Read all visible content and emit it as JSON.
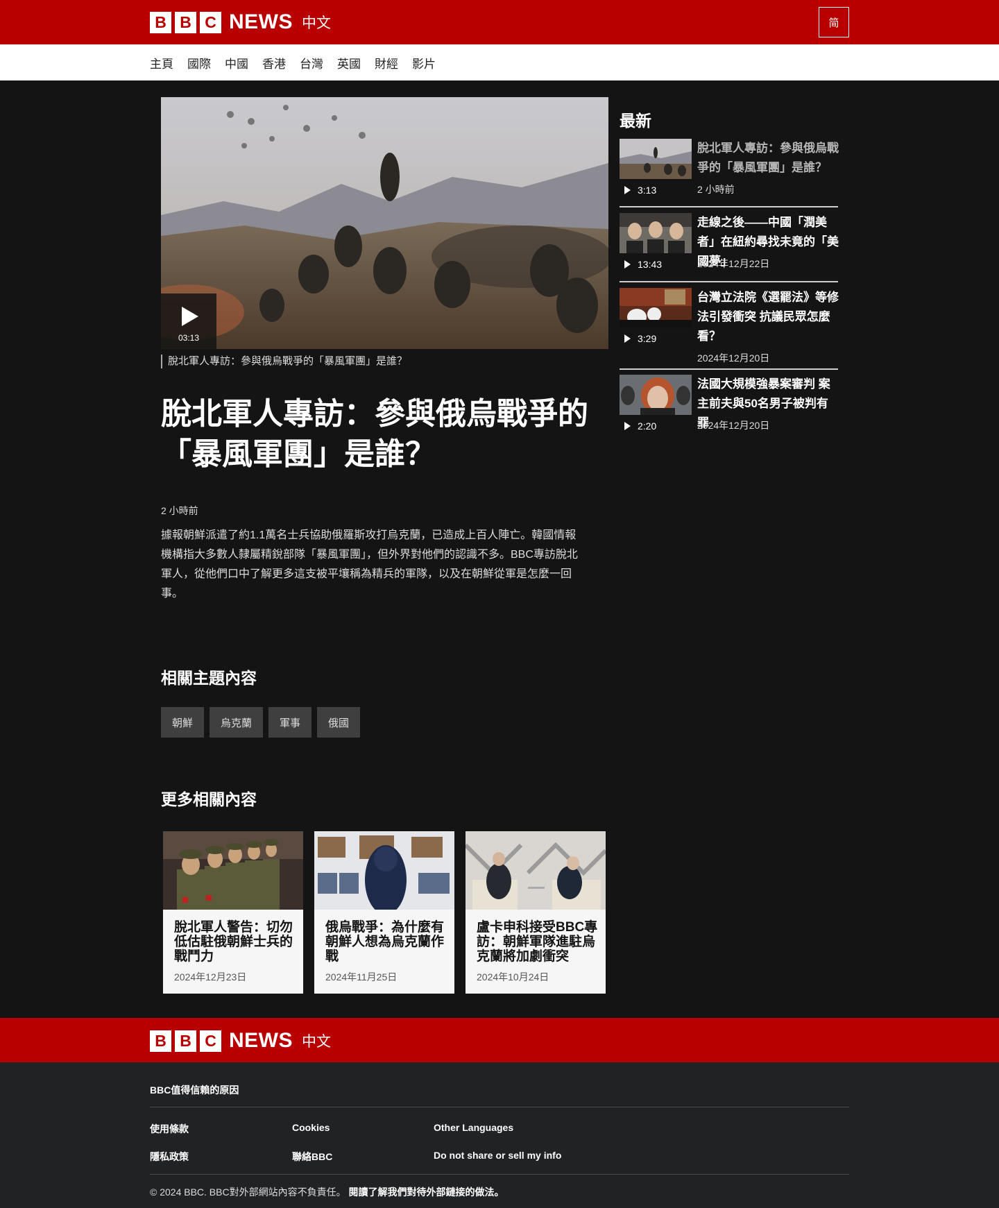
{
  "brand": {
    "b1": "B",
    "b2": "B",
    "b3": "C",
    "news": "NEWS",
    "zh": "中文"
  },
  "header": {
    "lang_toggle": "简"
  },
  "nav": {
    "items": [
      "主頁",
      "國際",
      "中國",
      "香港",
      "台灣",
      "英國",
      "財經",
      "影片"
    ]
  },
  "video": {
    "duration": "03:13",
    "caption": "脫北軍人專訪：參與俄烏戰爭的「暴風軍團」是誰？"
  },
  "article": {
    "headline": "脫北軍人專訪：參與俄烏戰爭的「暴風軍團」是誰？",
    "timestamp": "2 小時前",
    "summary": "據報朝鮮派遣了約1.1萬名士兵協助俄羅斯攻打烏克蘭，已造成上百人陣亡。韓國情報機構指大多數人隸屬精銳部隊「暴風軍團」，但外界對他們的認識不多。BBC專訪脫北軍人，從他們口中了解更多這支被平壤稱為精兵的軍隊，以及在朝鮮從軍是怎麼一回事。"
  },
  "topics": {
    "title": "相關主題內容",
    "tags": [
      "朝鮮",
      "烏克蘭",
      "軍事",
      "俄國"
    ]
  },
  "more": {
    "title": "更多相關內容",
    "cards": [
      {
        "title": "脫北軍人警告：切勿低估駐俄朝鮮士兵的戰鬥力",
        "date": "2024年12月23日"
      },
      {
        "title": "俄烏戰爭：為什麼有朝鮮人想為烏克蘭作戰",
        "date": "2024年11月25日"
      },
      {
        "title": "盧卡申科接受BBC專訪：朝鮮軍隊進駐烏克蘭將加劇衝突",
        "date": "2024年10月24日"
      }
    ]
  },
  "sidebar": {
    "title": "最新",
    "items": [
      {
        "title": "脫北軍人專訪：參與俄烏戰爭的「暴風軍團」是誰？",
        "duration": "3:13",
        "date": "2 小時前"
      },
      {
        "title": "走線之後——中國「潤美者」在紐約尋找未竟的「美國夢」",
        "duration": "13:43",
        "date": "2024年12月22日"
      },
      {
        "title": "台灣立法院《選罷法》等修法引發衝突 抗議民眾怎麼看？",
        "duration": "3:29",
        "date": "2024年12月20日"
      },
      {
        "title": "法國大規模強暴案審判 案主前夫與50名男子被判有罪",
        "duration": "2:20",
        "date": "2024年12月20日"
      }
    ]
  },
  "footer": {
    "trust": "BBC值得信賴的原因",
    "links": [
      "使用條款",
      "Cookies",
      "Other Languages",
      "隱私政策",
      "聯絡BBC",
      "Do not share or sell my info"
    ],
    "copyright": "© 2024 BBC. BBC對外部網站內容不負責任。",
    "external_link": "閱讀了解我們對待外部鏈接的做法。"
  },
  "colors": {
    "brand_red": "#b80000",
    "page_bg": "#141414",
    "footer_bg": "#202224"
  }
}
